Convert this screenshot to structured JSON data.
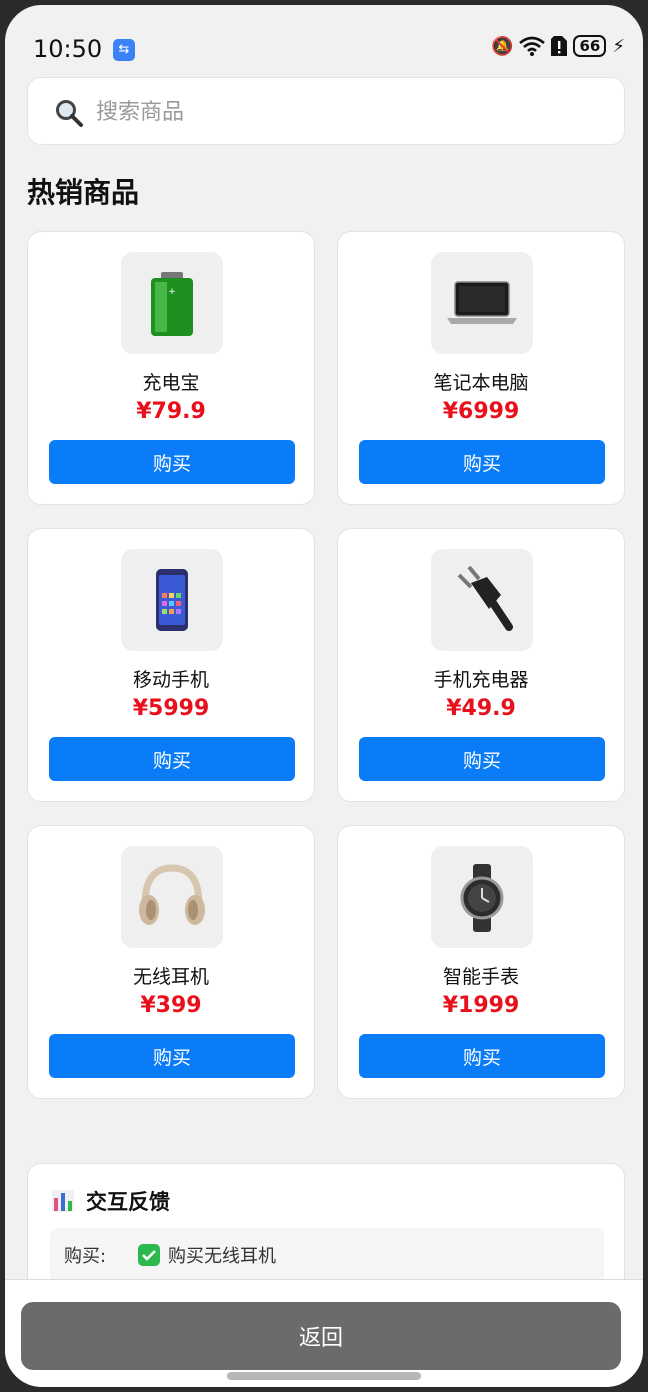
{
  "status": {
    "time": "10:50",
    "battery": "66"
  },
  "search": {
    "placeholder": "搜索商品"
  },
  "section_title": "热销商品",
  "products": [
    {
      "name": "充电宝",
      "price": "¥79.9",
      "buy_label": "购买",
      "icon": "power-bank-icon"
    },
    {
      "name": "笔记本电脑",
      "price": "¥6999",
      "buy_label": "购买",
      "icon": "laptop-icon"
    },
    {
      "name": "移动手机",
      "price": "¥5999",
      "buy_label": "购买",
      "icon": "phone-icon"
    },
    {
      "name": "手机充电器",
      "price": "¥49.9",
      "buy_label": "购买",
      "icon": "charger-icon"
    },
    {
      "name": "无线耳机",
      "price": "¥399",
      "buy_label": "购买",
      "icon": "headphones-icon"
    },
    {
      "name": "智能手表",
      "price": "¥1999",
      "buy_label": "购买",
      "icon": "smartwatch-icon"
    }
  ],
  "feedback": {
    "title": "交互反馈",
    "label": "购买:",
    "message": "购买无线耳机"
  },
  "back_label": "返回",
  "colors": {
    "accent": "#0a7cf8",
    "price": "#e8101a",
    "back": "#6b6b6b"
  }
}
